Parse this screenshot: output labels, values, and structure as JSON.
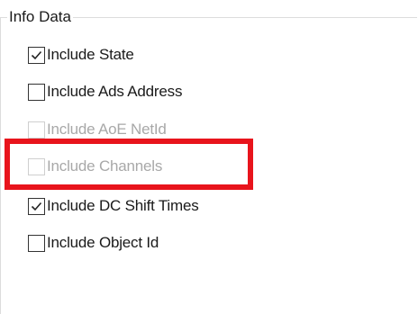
{
  "group": {
    "title": "Info Data"
  },
  "checkboxes": [
    {
      "label": "Include State",
      "checked": true,
      "enabled": true
    },
    {
      "label": "Include Ads Address",
      "checked": false,
      "enabled": true
    },
    {
      "label": "Include AoE NetId",
      "checked": false,
      "enabled": false
    },
    {
      "label": "Include Channels",
      "checked": false,
      "enabled": false
    },
    {
      "label": "Include DC Shift Times",
      "checked": true,
      "enabled": true
    },
    {
      "label": "Include Object Id",
      "checked": false,
      "enabled": true
    }
  ],
  "colors": {
    "highlight": "#e8141c",
    "disabled_text": "#a8a8a8",
    "text": "#1a1a1a"
  }
}
